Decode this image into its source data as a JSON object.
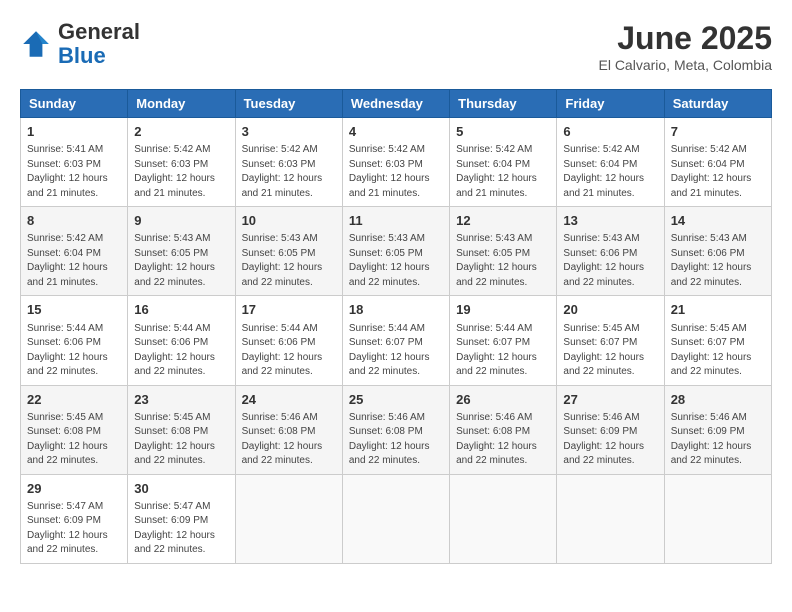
{
  "logo": {
    "general": "General",
    "blue": "Blue"
  },
  "title": {
    "month_year": "June 2025",
    "location": "El Calvario, Meta, Colombia"
  },
  "headers": [
    "Sunday",
    "Monday",
    "Tuesday",
    "Wednesday",
    "Thursday",
    "Friday",
    "Saturday"
  ],
  "weeks": [
    [
      {
        "day": "1",
        "info": "Sunrise: 5:41 AM\nSunset: 6:03 PM\nDaylight: 12 hours\nand 21 minutes."
      },
      {
        "day": "2",
        "info": "Sunrise: 5:42 AM\nSunset: 6:03 PM\nDaylight: 12 hours\nand 21 minutes."
      },
      {
        "day": "3",
        "info": "Sunrise: 5:42 AM\nSunset: 6:03 PM\nDaylight: 12 hours\nand 21 minutes."
      },
      {
        "day": "4",
        "info": "Sunrise: 5:42 AM\nSunset: 6:03 PM\nDaylight: 12 hours\nand 21 minutes."
      },
      {
        "day": "5",
        "info": "Sunrise: 5:42 AM\nSunset: 6:04 PM\nDaylight: 12 hours\nand 21 minutes."
      },
      {
        "day": "6",
        "info": "Sunrise: 5:42 AM\nSunset: 6:04 PM\nDaylight: 12 hours\nand 21 minutes."
      },
      {
        "day": "7",
        "info": "Sunrise: 5:42 AM\nSunset: 6:04 PM\nDaylight: 12 hours\nand 21 minutes."
      }
    ],
    [
      {
        "day": "8",
        "info": "Sunrise: 5:42 AM\nSunset: 6:04 PM\nDaylight: 12 hours\nand 21 minutes."
      },
      {
        "day": "9",
        "info": "Sunrise: 5:43 AM\nSunset: 6:05 PM\nDaylight: 12 hours\nand 22 minutes."
      },
      {
        "day": "10",
        "info": "Sunrise: 5:43 AM\nSunset: 6:05 PM\nDaylight: 12 hours\nand 22 minutes."
      },
      {
        "day": "11",
        "info": "Sunrise: 5:43 AM\nSunset: 6:05 PM\nDaylight: 12 hours\nand 22 minutes."
      },
      {
        "day": "12",
        "info": "Sunrise: 5:43 AM\nSunset: 6:05 PM\nDaylight: 12 hours\nand 22 minutes."
      },
      {
        "day": "13",
        "info": "Sunrise: 5:43 AM\nSunset: 6:06 PM\nDaylight: 12 hours\nand 22 minutes."
      },
      {
        "day": "14",
        "info": "Sunrise: 5:43 AM\nSunset: 6:06 PM\nDaylight: 12 hours\nand 22 minutes."
      }
    ],
    [
      {
        "day": "15",
        "info": "Sunrise: 5:44 AM\nSunset: 6:06 PM\nDaylight: 12 hours\nand 22 minutes."
      },
      {
        "day": "16",
        "info": "Sunrise: 5:44 AM\nSunset: 6:06 PM\nDaylight: 12 hours\nand 22 minutes."
      },
      {
        "day": "17",
        "info": "Sunrise: 5:44 AM\nSunset: 6:06 PM\nDaylight: 12 hours\nand 22 minutes."
      },
      {
        "day": "18",
        "info": "Sunrise: 5:44 AM\nSunset: 6:07 PM\nDaylight: 12 hours\nand 22 minutes."
      },
      {
        "day": "19",
        "info": "Sunrise: 5:44 AM\nSunset: 6:07 PM\nDaylight: 12 hours\nand 22 minutes."
      },
      {
        "day": "20",
        "info": "Sunrise: 5:45 AM\nSunset: 6:07 PM\nDaylight: 12 hours\nand 22 minutes."
      },
      {
        "day": "21",
        "info": "Sunrise: 5:45 AM\nSunset: 6:07 PM\nDaylight: 12 hours\nand 22 minutes."
      }
    ],
    [
      {
        "day": "22",
        "info": "Sunrise: 5:45 AM\nSunset: 6:08 PM\nDaylight: 12 hours\nand 22 minutes."
      },
      {
        "day": "23",
        "info": "Sunrise: 5:45 AM\nSunset: 6:08 PM\nDaylight: 12 hours\nand 22 minutes."
      },
      {
        "day": "24",
        "info": "Sunrise: 5:46 AM\nSunset: 6:08 PM\nDaylight: 12 hours\nand 22 minutes."
      },
      {
        "day": "25",
        "info": "Sunrise: 5:46 AM\nSunset: 6:08 PM\nDaylight: 12 hours\nand 22 minutes."
      },
      {
        "day": "26",
        "info": "Sunrise: 5:46 AM\nSunset: 6:08 PM\nDaylight: 12 hours\nand 22 minutes."
      },
      {
        "day": "27",
        "info": "Sunrise: 5:46 AM\nSunset: 6:09 PM\nDaylight: 12 hours\nand 22 minutes."
      },
      {
        "day": "28",
        "info": "Sunrise: 5:46 AM\nSunset: 6:09 PM\nDaylight: 12 hours\nand 22 minutes."
      }
    ],
    [
      {
        "day": "29",
        "info": "Sunrise: 5:47 AM\nSunset: 6:09 PM\nDaylight: 12 hours\nand 22 minutes."
      },
      {
        "day": "30",
        "info": "Sunrise: 5:47 AM\nSunset: 6:09 PM\nDaylight: 12 hours\nand 22 minutes."
      },
      {
        "day": "",
        "info": ""
      },
      {
        "day": "",
        "info": ""
      },
      {
        "day": "",
        "info": ""
      },
      {
        "day": "",
        "info": ""
      },
      {
        "day": "",
        "info": ""
      }
    ]
  ]
}
